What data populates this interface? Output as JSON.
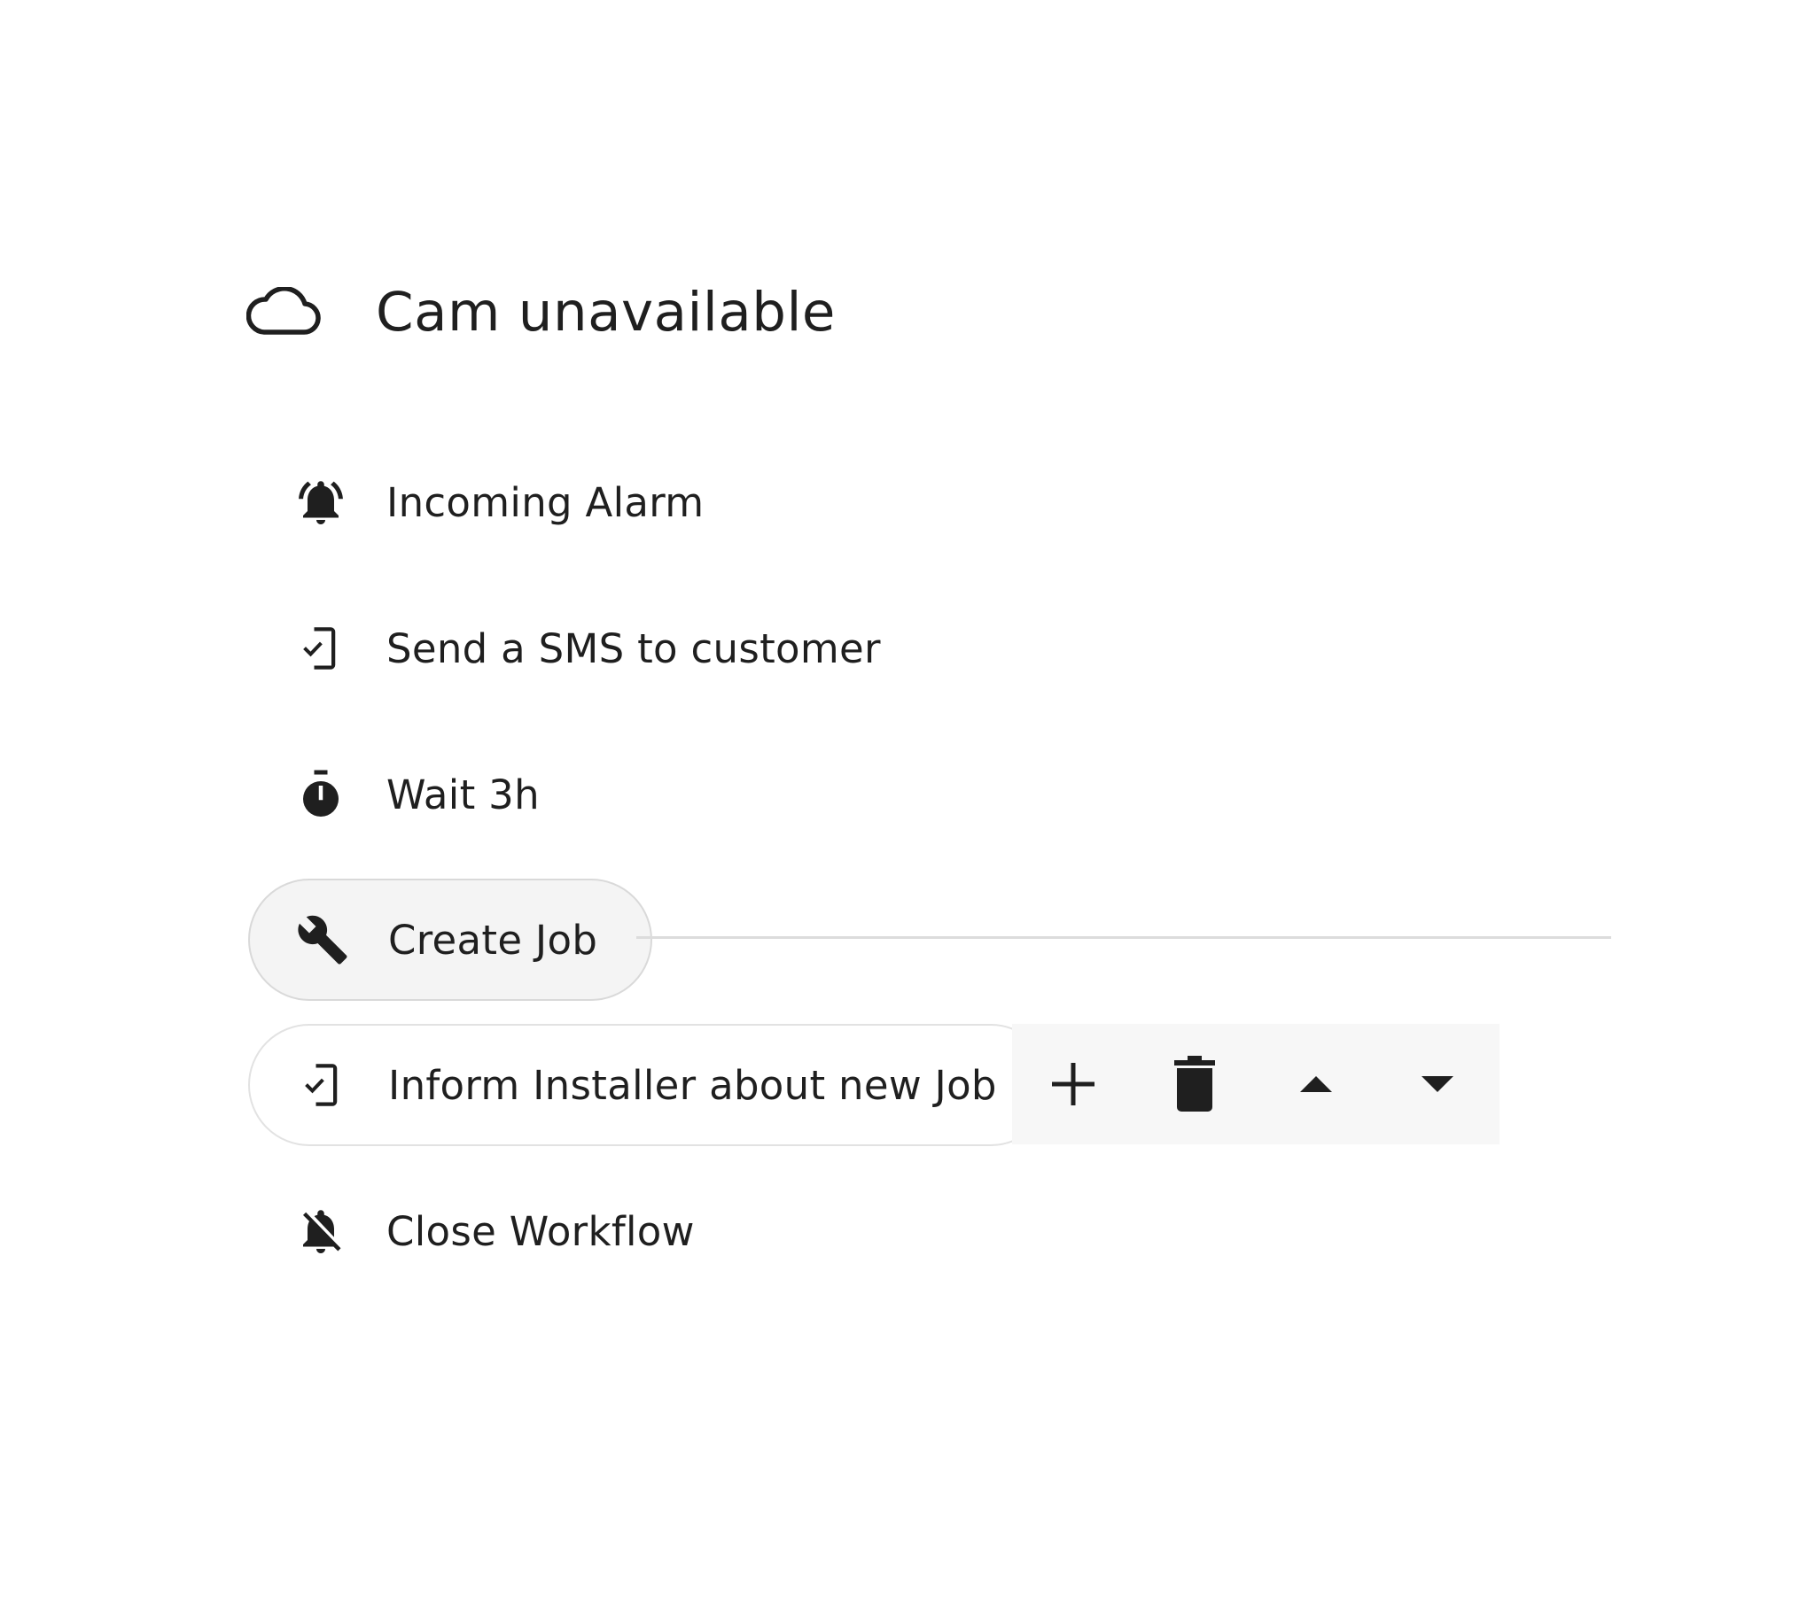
{
  "workflow": {
    "title": "Cam unavailable",
    "title_icon": "cloud-icon"
  },
  "steps": [
    {
      "label": "Incoming Alarm",
      "icon": "bell-ring-icon",
      "state": "default"
    },
    {
      "label": "Send a SMS to customer",
      "icon": "phone-check-icon",
      "state": "default"
    },
    {
      "label": "Wait 3h",
      "icon": "timer-icon",
      "state": "default"
    },
    {
      "label": "Create Job",
      "icon": "wrench-icon",
      "state": "selected"
    },
    {
      "label": "Inform Installer about new Job",
      "icon": "phone-check-icon",
      "state": "hovered"
    },
    {
      "label": "Close Workflow",
      "icon": "bell-off-icon",
      "state": "default"
    }
  ],
  "toolbar": {
    "actions": [
      {
        "name": "add",
        "icon": "plus-icon"
      },
      {
        "name": "delete",
        "icon": "trash-icon"
      },
      {
        "name": "move-up",
        "icon": "caret-up-icon"
      },
      {
        "name": "move-down",
        "icon": "caret-down-icon"
      }
    ]
  },
  "colors": {
    "text": "#1f1f1f",
    "selected_bg": "#f4f4f4",
    "border": "#d9d9d9",
    "toolbar_bg": "#f7f7f7",
    "connector": "#dcdcdc"
  }
}
